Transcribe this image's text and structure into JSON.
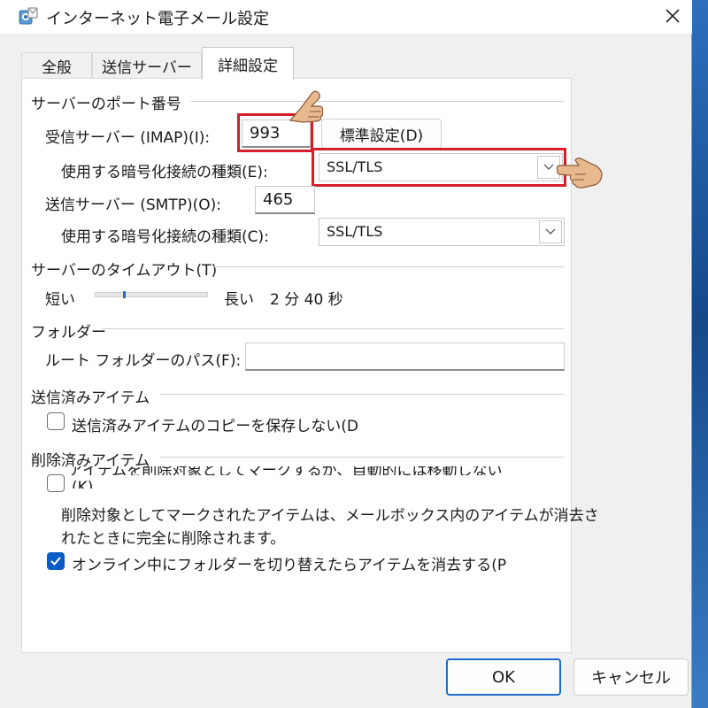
{
  "window": {
    "title": "インターネット電子メール設定",
    "close_icon": "close-icon",
    "app_icon": "mail-settings-icon"
  },
  "tabs": [
    {
      "label": "全般",
      "active": false
    },
    {
      "label": "送信サーバー",
      "active": false
    },
    {
      "label": "詳細設定",
      "active": true
    }
  ],
  "port_section": {
    "title": "サーバーのポート番号",
    "incoming_label": "受信サーバー (IMAP)(I):",
    "incoming_value": "993",
    "default_button": "標準設定(D)",
    "incoming_enc_label": "使用する暗号化接続の種類(E):",
    "incoming_enc_value": "SSL/TLS",
    "outgoing_label": "送信サーバー (SMTP)(O):",
    "outgoing_value": "465",
    "outgoing_enc_label": "使用する暗号化接続の種類(C):",
    "outgoing_enc_value": "SSL/TLS"
  },
  "timeout_section": {
    "title": "サーバーのタイムアウト(T)",
    "short_label": "短い",
    "long_label": "長い",
    "value_text": "2 分 40 秒",
    "slider_level": 0.25
  },
  "folder_section": {
    "title": "フォルダー",
    "root_label": "ルート フォルダーのパス(F):",
    "root_value": ""
  },
  "sent_section": {
    "title": "送信済みアイテム",
    "no_copy_label": "送信済みアイテムのコピーを保存しない(D",
    "no_copy_checked": false
  },
  "deleted_section": {
    "title": "削除済みアイテム",
    "mark_label_line1": "アイテムを削除対象としてマークするが、自動的には移動しない",
    "mark_label_line2": "(K)",
    "mark_checked": false,
    "desc_line1": "削除対象としてマークされたアイテムは、メールボックス内のアイテムが消去さ",
    "desc_line2": "れたときに完全に削除されます。",
    "purge_label": "オンライン中にフォルダーを切り替えたらアイテムを消去する(P",
    "purge_checked": true
  },
  "buttons": {
    "ok": "OK",
    "cancel": "キャンセル"
  },
  "colors": {
    "highlight": "#d21f2b",
    "accent": "#0a5cc6"
  },
  "annotations": {
    "pointer_icon": "pointing-hand-icon"
  }
}
